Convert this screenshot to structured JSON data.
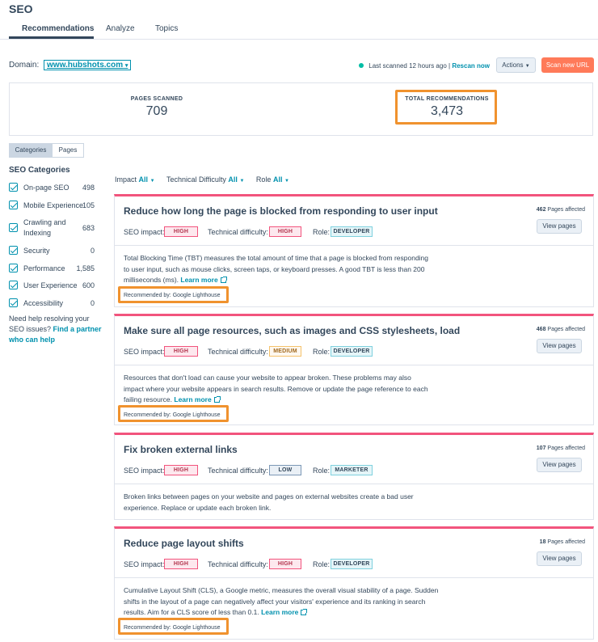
{
  "app": {
    "title": "SEO"
  },
  "tabs": [
    {
      "label": "Recommendations"
    },
    {
      "label": "Analyze"
    },
    {
      "label": "Topics"
    }
  ],
  "domain": {
    "label": "Domain:",
    "value": "www.hubshots.com"
  },
  "scan_status": {
    "text": "Last scanned 12 hours ago |",
    "rescan": "Rescan now"
  },
  "buttons": {
    "actions": "Actions",
    "scan_new_url": "Scan new URL"
  },
  "stats": {
    "pages_scanned_label": "PAGES SCANNED",
    "pages_scanned": "709",
    "total_recs_label": "TOTAL RECOMMENDATIONS",
    "total_recs": "3,473"
  },
  "view_toggle": {
    "categories": "Categories",
    "pages": "Pages"
  },
  "sidebar": {
    "heading": "SEO Categories",
    "items": [
      {
        "label": "On-page SEO",
        "count": "498"
      },
      {
        "label": "Mobile Experience",
        "count": "105"
      },
      {
        "label": "Crawling and Indexing",
        "count": "683"
      },
      {
        "label": "Security",
        "count": "0"
      },
      {
        "label": "Performance",
        "count": "1,585"
      },
      {
        "label": "User Experience",
        "count": "600"
      },
      {
        "label": "Accessibility",
        "count": "0"
      }
    ],
    "help_text": "Need help resolving your SEO issues?",
    "help_link": "Find a partner who can help"
  },
  "filters": {
    "impact_label": "Impact",
    "impact_value": "All",
    "difficulty_label": "Technical Difficulty",
    "difficulty_value": "All",
    "role_label": "Role",
    "role_value": "All"
  },
  "card_labels": {
    "seo_impact": "SEO impact:",
    "tech_difficulty": "Technical difficulty:",
    "role": "Role:",
    "view_pages": "View pages",
    "pages_affected": "Pages affected",
    "learn_more": "Learn more"
  },
  "recommendations": [
    {
      "title": "Reduce how long the page is blocked from responding to user input",
      "pages_affected": "462",
      "impact": "HIGH",
      "difficulty": "HIGH",
      "role": "DEVELOPER",
      "description": "Total Blocking Time (TBT) measures the total amount of time that a page is blocked from responding to user input, such as mouse clicks, screen taps, or keyboard presses. A good TBT is less than 200 milliseconds (ms).",
      "recommended_by": "Recommended by: Google Lighthouse"
    },
    {
      "title": "Make sure all page resources, such as images and CSS stylesheets, load",
      "pages_affected": "468",
      "impact": "HIGH",
      "difficulty": "MEDIUM",
      "role": "DEVELOPER",
      "description": "Resources that don't load can cause your website to appear broken. These problems may also impact where your website appears in search results. Remove or update the page reference to each failing resource.",
      "recommended_by": "Recommended by: Google Lighthouse"
    },
    {
      "title": "Fix broken external links",
      "pages_affected": "107",
      "impact": "HIGH",
      "difficulty": "LOW",
      "role": "MARKETER",
      "description": "Broken links between pages on your website and pages on external websites create a bad user experience. Replace or update each broken link."
    },
    {
      "title": "Reduce page layout shifts",
      "pages_affected": "18",
      "impact": "HIGH",
      "difficulty": "HIGH",
      "role": "DEVELOPER",
      "description": "Cumulative Layout Shift (CLS), a Google metric, measures the overall visual stability of a page. Sudden shifts in the layout of a page can negatively affect your visitors' experience and its ranking in search results. Aim for a CLS score of less than 0.1.",
      "recommended_by": "Recommended by: Google Lighthouse"
    }
  ],
  "colors": {
    "accent": "#0091ae",
    "orange": "#ff7a59",
    "highlight": "#f0922e",
    "card_top": "#f2547d"
  }
}
